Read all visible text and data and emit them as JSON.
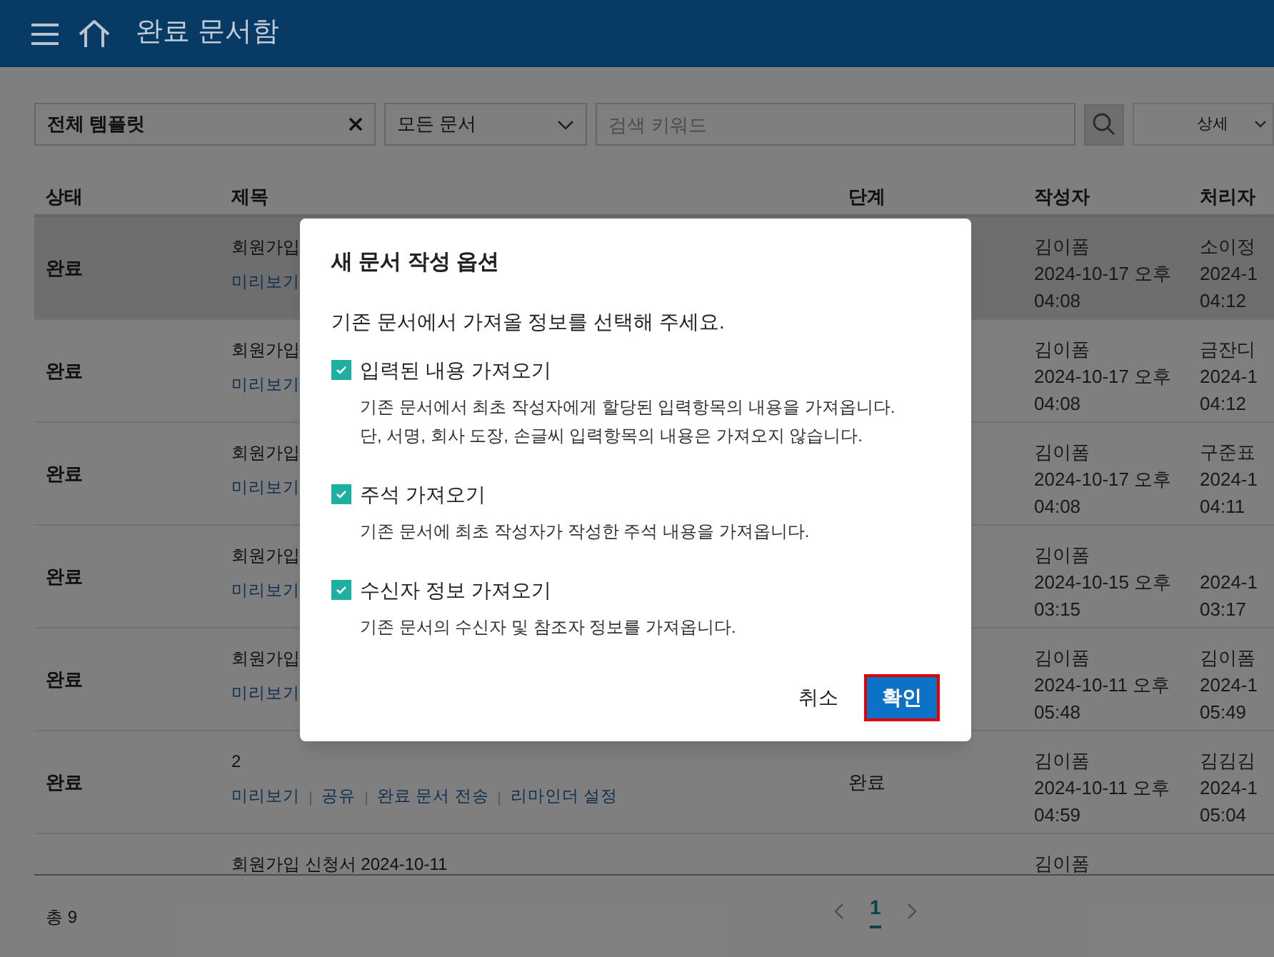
{
  "header": {
    "title": "완료 문서함"
  },
  "filters": {
    "template": {
      "value": "전체 템플릿"
    },
    "documents": {
      "value": "모든 문서"
    },
    "search": {
      "placeholder": "검색 키워드"
    },
    "detail": {
      "label": "상세"
    }
  },
  "table": {
    "columns": [
      "상태",
      "제목",
      "단계",
      "작성자",
      "처리자"
    ],
    "rows": [
      {
        "selected": true,
        "status": "완료",
        "title": "회원가입",
        "actions": [
          "미리보기"
        ],
        "author": "김이폼",
        "author_date": "2024-10-17 오후",
        "author_time": "04:08",
        "processor": "소이정",
        "processor_date": "2024-1",
        "processor_time": "04:12"
      },
      {
        "selected": false,
        "status": "완료",
        "title": "회원가입",
        "actions": [
          "미리보기"
        ],
        "author": "김이폼",
        "author_date": "2024-10-17 오후",
        "author_time": "04:08",
        "processor": "금잔디",
        "processor_date": "2024-1",
        "processor_time": "04:12"
      },
      {
        "selected": false,
        "status": "완료",
        "title": "회원가입",
        "actions": [
          "미리보기"
        ],
        "author": "김이폼",
        "author_date": "2024-10-17 오후",
        "author_time": "04:08",
        "processor": "구준표",
        "processor_date": "2024-1",
        "processor_time": "04:11"
      },
      {
        "selected": false,
        "status": "완료",
        "title": "회원가입",
        "actions": [
          "미리보기"
        ],
        "author": "김이폼",
        "author_date": "2024-10-15 오후",
        "author_time": "03:15",
        "processor_date": "2024-1",
        "processor_time": "03:17"
      },
      {
        "selected": false,
        "status": "완료",
        "title": "회원가입",
        "actions": [
          "미리보기"
        ],
        "author": "김이폼",
        "author_date": "2024-10-11 오후",
        "author_time": "05:48",
        "processor": "김이폼",
        "processor_date": "2024-1",
        "processor_time": "05:49"
      },
      {
        "selected": false,
        "status": "완료",
        "title": "2",
        "actions": [
          "미리보기",
          "공유",
          "완료 문서 전송",
          "리마인더 설정"
        ],
        "stage": "완료",
        "author": "김이폼",
        "author_date": "2024-10-11 오후",
        "author_time": "04:59",
        "processor": "김김김",
        "processor_date": "2024-1",
        "processor_time": "05:04"
      },
      {
        "selected": false,
        "title": "회원가입 신청서 2024-10-11",
        "author": "김이폼"
      }
    ]
  },
  "footer": {
    "total": "총 9",
    "pages": [
      {
        "label": "1",
        "selected": true
      }
    ]
  },
  "dialog": {
    "title": "새 문서 작성 옵션",
    "intro": "기존 문서에서 가져올 정보를 선택해 주세요.",
    "options": [
      {
        "label": "입력된 내용 가져오기",
        "checked": true,
        "description": [
          "기존 문서에서 최초 작성자에게 할당된 입력항목의 내용을 가져옵니다.",
          "단, 서명, 회사 도장, 손글씨 입력항목의 내용은 가져오지 않습니다."
        ]
      },
      {
        "label": "주석 가져오기",
        "checked": true,
        "description": [
          "기존 문서에 최초 작성자가 작성한 주석 내용을 가져옵니다."
        ]
      },
      {
        "label": "수신자 정보 가져오기",
        "checked": true,
        "description": [
          "기존 문서의 수신자 및 참조자 정보를 가져옵니다."
        ]
      }
    ],
    "cancel": "취소",
    "confirm": "확인"
  }
}
